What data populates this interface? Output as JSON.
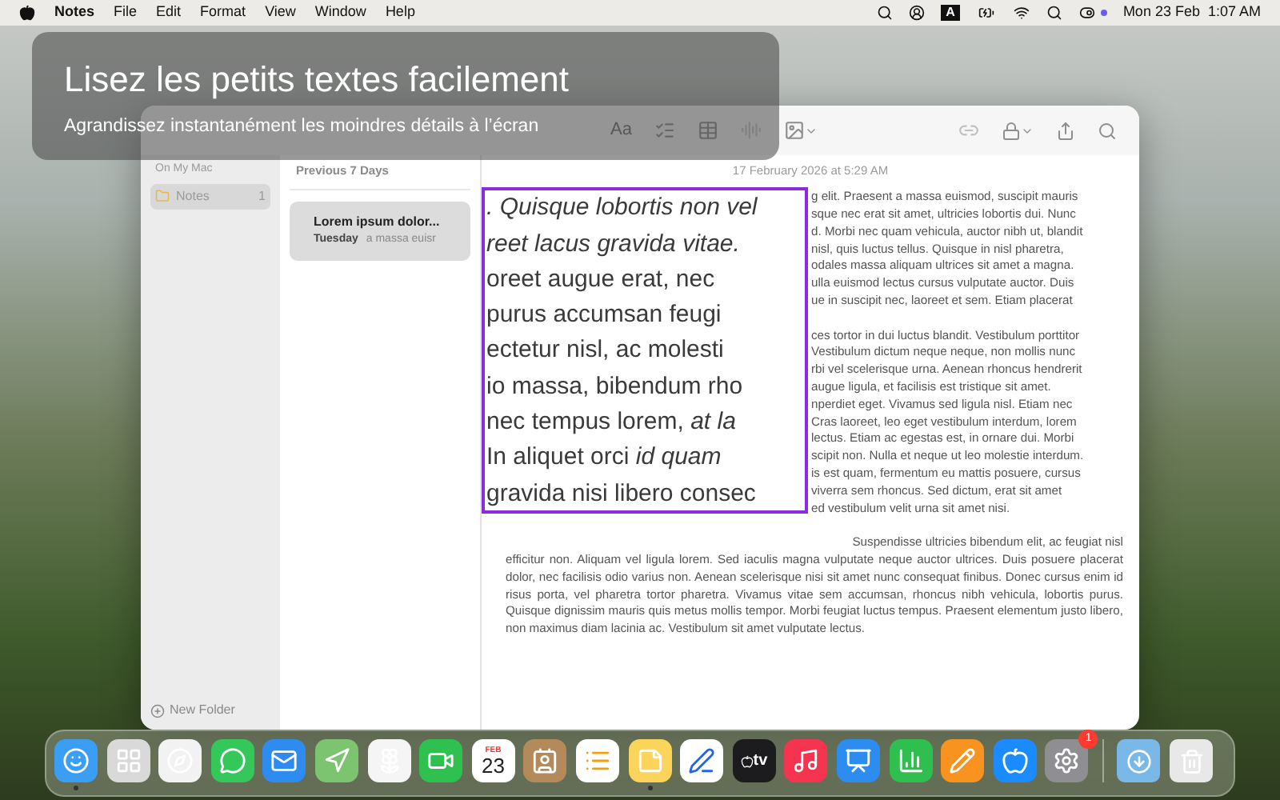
{
  "menu_bar": {
    "app_name": "Notes",
    "menus": [
      "File",
      "Edit",
      "Format",
      "View",
      "Window",
      "Help"
    ],
    "input_source": "A",
    "date": "Mon 23 Feb",
    "time": "1:07 AM"
  },
  "overlay": {
    "title": "Lisez les petits textes facilement",
    "subtitle": "Agrandissez instantanément les moindres détails à l’écran"
  },
  "window": {
    "toolbar": {
      "format_label": "Aa"
    },
    "sidebar": {
      "section": "On My Mac",
      "items": [
        {
          "label": "Notes",
          "count": "1",
          "selected": true
        }
      ],
      "new_folder": "New Folder"
    },
    "note_list": {
      "section": "Previous 7 Days",
      "notes": [
        {
          "title": "Lorem ipsum dolor...",
          "date": "Tuesday",
          "preview": "a massa euisr",
          "selected": true
        }
      ]
    },
    "note": {
      "date": "17 February 2026 at 5:29 AM",
      "magnifier_lines": [
        "*. Quisque lobortis non vel*",
        "*reet lacus gravida vitae.*",
        "oreet augue erat, nec",
        "purus accumsan feugi",
        "ectetur nisl, ac molesti",
        "io massa, bibendum rho",
        "nec tempus lorem, *at la*",
        "In aliquet orci *id quam*",
        "gravida nisi libero consec"
      ],
      "side_paragraphs": [
        [
          "g elit. Praesent a massa euismod, suscipit mauris",
          "sque nec erat sit amet, ultricies lobortis dui. Nunc",
          "d. Morbi nec quam vehicula, auctor nibh ut, blandit",
          "nisl, quis luctus tellus. Quisque in nisl pharetra,",
          "odales massa aliquam ultrices sit amet a magna.",
          "ulla euismod lectus cursus vulputate auctor. Duis",
          "ue in suscipit nec, laoreet et sem. Etiam placerat"
        ],
        [
          "ces tortor in dui luctus blandit. Vestibulum porttitor",
          "Vestibulum dictum neque neque, non mollis nunc",
          "rbi vel scelerisque urna. Aenean rhoncus hendrerit",
          "augue ligula, et facilisis est tristique sit amet.",
          "nperdiet eget. Vivamus sed ligula nisl. Etiam nec",
          "Cras laoreet, leo eget vestibulum interdum, lorem",
          "lectus. Etiam ac egestas est, in ornare dui. Morbi",
          "scipit non. Nulla et neque ut leo molestie interdum.",
          "is est quam, fermentum eu mattis posuere, cursus",
          "viverra sem rhoncus. Sed dictum, erat sit amet",
          "ed vestibulum velit urna sit amet nisi."
        ]
      ],
      "partial_line": "Suspendisse ultricies bibendum elit, ac feugiat nisl",
      "paragraph": "efficitur non. Aliquam vel ligula lorem. Sed iaculis magna vulputate neque auctor ultrices. Duis posuere placerat dolor, nec facilisis odio varius non. Aenean scelerisque nisi sit amet nunc consequat finibus. Donec cursus enim id risus porta, vel pharetra tortor pharetra. Vivamus vitae sem accumsan, rhoncus nibh vehicula, lobortis purus. Quisque dignissim mauris quis metus mollis tempor. Morbi feugiat luctus tempus. Praesent elementum justo libero, non maximus diam lacinia ac. Vestibulum sit amet vulputate lectus."
    }
  },
  "dock": {
    "apps": [
      {
        "kind": "finder",
        "running": true
      },
      {
        "kind": "launchpad",
        "running": false
      },
      {
        "kind": "safari",
        "running": false
      },
      {
        "kind": "messages",
        "running": false
      },
      {
        "kind": "mail",
        "running": false
      },
      {
        "kind": "maps",
        "running": false
      },
      {
        "kind": "photos",
        "running": false
      },
      {
        "kind": "facetime",
        "running": false
      },
      {
        "kind": "calendar",
        "running": false,
        "month": "FEB",
        "day": "23"
      },
      {
        "kind": "contacts",
        "running": false
      },
      {
        "kind": "reminders",
        "running": false
      },
      {
        "kind": "notes",
        "running": true
      },
      {
        "kind": "freeform",
        "running": false
      },
      {
        "kind": "tv",
        "running": false,
        "label": "tv"
      },
      {
        "kind": "music",
        "running": false
      },
      {
        "kind": "keynote",
        "running": false
      },
      {
        "kind": "numbers",
        "running": false
      },
      {
        "kind": "pages",
        "running": false
      },
      {
        "kind": "appstore",
        "running": false
      },
      {
        "kind": "settings",
        "running": false,
        "badge": "1"
      }
    ],
    "others": [
      {
        "kind": "downloads"
      },
      {
        "kind": "trash"
      }
    ]
  }
}
